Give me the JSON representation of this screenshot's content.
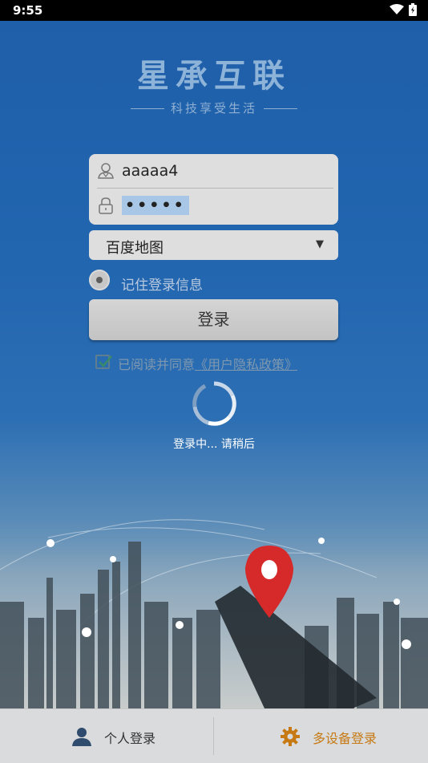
{
  "status_bar": {
    "time": "9:55"
  },
  "brand": {
    "title": "星承互联",
    "slogan": "科技享受生活"
  },
  "login": {
    "username_value": "aaaaa4",
    "password_value": "•••••",
    "map_selected": "百度地图",
    "remember_label": "记住登录信息",
    "login_button": "登录",
    "agree_prefix": "已阅读并同意",
    "agree_link": "《用户隐私政策》"
  },
  "loading": {
    "text": "登录中... 请稍后"
  },
  "bottom_tabs": {
    "personal_login": "个人登录",
    "multi_device_login": "多设备登录"
  },
  "colors": {
    "accent": "#c77a14",
    "background": "#1f5ea9"
  }
}
